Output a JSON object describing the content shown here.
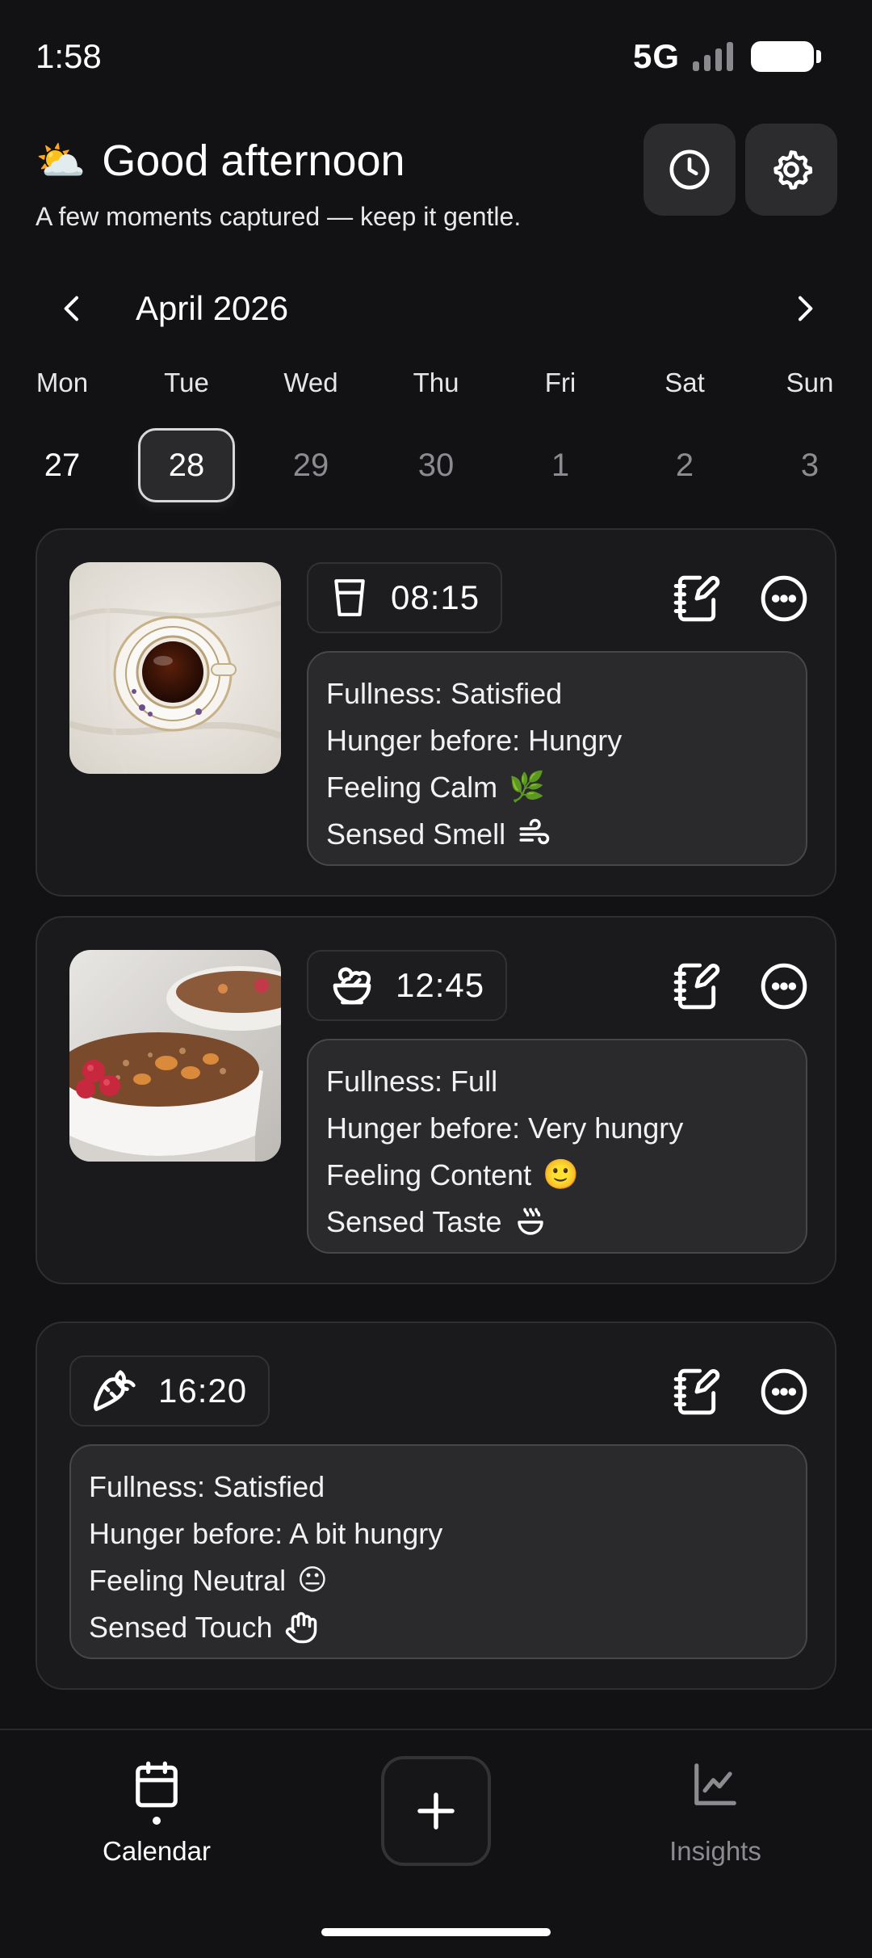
{
  "status_bar": {
    "time": "1:58",
    "network": "5G"
  },
  "header": {
    "weather_emoji": "⛅",
    "greeting": "Good afternoon",
    "subtitle": "A few moments captured — keep it gentle.",
    "buttons": [
      "history",
      "settings"
    ]
  },
  "calendar": {
    "month": "April 2026",
    "days": [
      {
        "name": "Mon",
        "num": "27",
        "state": "past"
      },
      {
        "name": "Tue",
        "num": "28",
        "state": "selected"
      },
      {
        "name": "Wed",
        "num": "29",
        "state": "future"
      },
      {
        "name": "Thu",
        "num": "30",
        "state": "future"
      },
      {
        "name": "Fri",
        "num": "1",
        "state": "future"
      },
      {
        "name": "Sat",
        "num": "2",
        "state": "future"
      },
      {
        "name": "Sun",
        "num": "3",
        "state": "future"
      }
    ]
  },
  "entries": [
    {
      "time": "08:15",
      "type_icon": "cup-icon",
      "image": "tea-cup-photo",
      "fullness": "Fullness: Satisfied",
      "hunger": "Hunger before: Hungry",
      "feeling": "Feeling Calm",
      "feeling_emoji": "🌿",
      "sense": "Sensed Smell",
      "sense_icon": "wind-icon"
    },
    {
      "time": "12:45",
      "type_icon": "salad-bowl-icon",
      "image": "granola-bowl-photo",
      "fullness": "Fullness: Full",
      "hunger": "Hunger before: Very hungry",
      "feeling": "Feeling Content",
      "feeling_emoji": "🙂",
      "sense": "Sensed Taste",
      "sense_icon": "taste-icon"
    },
    {
      "time": "16:20",
      "type_icon": "carrot-icon",
      "image": null,
      "fullness": "Fullness: Satisfied",
      "hunger": "Hunger before: A bit hungry",
      "feeling": "Feeling Neutral",
      "feeling_emoji": "😐",
      "sense": "Sensed Touch",
      "sense_icon": "hand-icon"
    }
  ],
  "bottom_nav": {
    "calendar_label": "Calendar",
    "insights_label": "Insights",
    "active": "calendar"
  }
}
